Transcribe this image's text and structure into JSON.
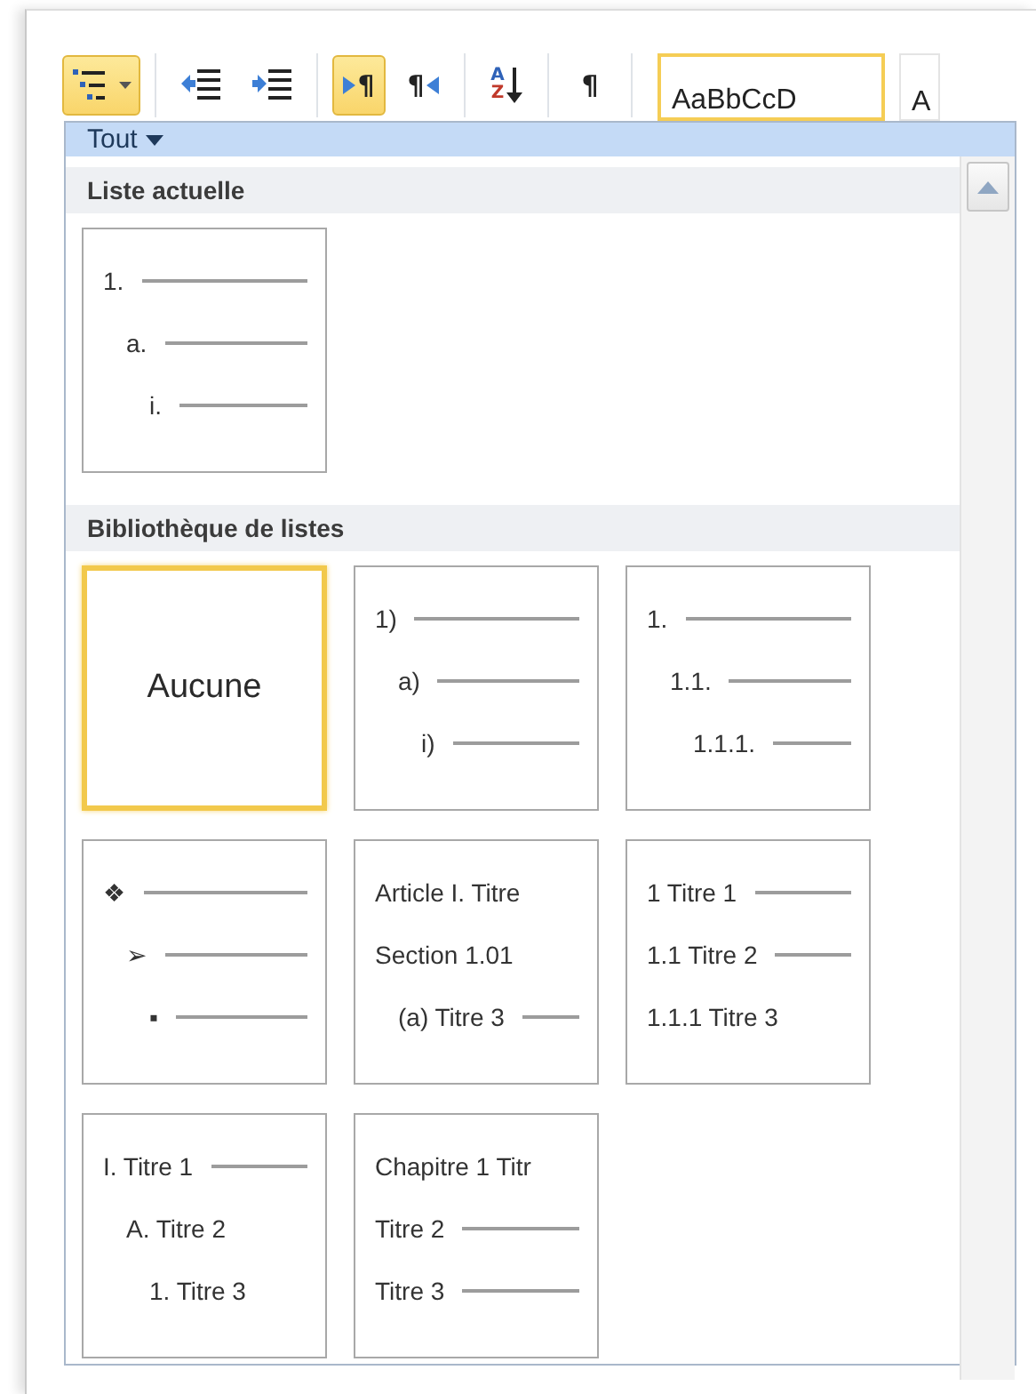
{
  "toolbar": {
    "groups": [
      [
        {
          "kind": "multilevel-list",
          "selected": true
        }
      ],
      [
        {
          "kind": "decrease-indent",
          "selected": false
        },
        {
          "kind": "increase-indent",
          "selected": false
        }
      ],
      [
        {
          "kind": "left-to-right",
          "mark": "¶",
          "selected": true
        },
        {
          "kind": "right-to-left",
          "mark": "¶",
          "selected": false
        }
      ],
      [
        {
          "kind": "sort",
          "letters": [
            "A",
            "Z"
          ],
          "selected": false
        }
      ],
      [
        {
          "kind": "show-marks",
          "mark": "¶",
          "selected": false
        }
      ]
    ],
    "styles": [
      {
        "sample": "AaBbCcD",
        "selected": true
      },
      {
        "sample": "A",
        "selected": false
      }
    ]
  },
  "dropdown": {
    "filter": {
      "label": "Tout"
    },
    "sections": [
      {
        "title": "Liste actuelle",
        "tiles": [
          {
            "kind": "outline",
            "selected": false,
            "lines": [
              {
                "label": "1.",
                "rule": true,
                "children": [
                  {
                    "label": "a.",
                    "rule": true,
                    "children": [
                      {
                        "label": "i.",
                        "rule": true
                      }
                    ]
                  }
                ]
              }
            ]
          }
        ]
      },
      {
        "title": "Bibliothèque de listes",
        "tiles": [
          {
            "kind": "none",
            "selected": true,
            "label": "Aucune"
          },
          {
            "kind": "outline",
            "selected": false,
            "lines": [
              {
                "label": "1)",
                "rule": true,
                "children": [
                  {
                    "label": "a)",
                    "rule": true,
                    "children": [
                      {
                        "label": "i)",
                        "rule": true
                      }
                    ]
                  }
                ]
              }
            ]
          },
          {
            "kind": "outline",
            "selected": false,
            "lines": [
              {
                "label": "1.",
                "rule": true,
                "children": [
                  {
                    "label": "1.1.",
                    "rule": true,
                    "children": [
                      {
                        "label": "1.1.1.",
                        "rule": true
                      }
                    ]
                  }
                ]
              }
            ]
          },
          {
            "kind": "outline",
            "selected": false,
            "lines": [
              {
                "label": "❖",
                "rule": true,
                "children": [
                  {
                    "label": "➢",
                    "rule": true,
                    "children": [
                      {
                        "label": "▪",
                        "rule": true
                      }
                    ]
                  }
                ]
              }
            ]
          },
          {
            "kind": "outline",
            "selected": false,
            "lines": [
              {
                "label": "Article I. Titre",
                "rule": false
              },
              {
                "label": "Section 1.01",
                "rule": false,
                "children": [
                  {
                    "label": "(a) Titre 3",
                    "rule": true
                  }
                ]
              }
            ]
          },
          {
            "kind": "outline",
            "selected": false,
            "lines": [
              {
                "label": "1 Titre 1",
                "rule": true
              },
              {
                "label": "1.1 Titre 2",
                "rule": true
              },
              {
                "label": "1.1.1 Titre 3",
                "rule": false
              }
            ]
          },
          {
            "kind": "outline",
            "selected": false,
            "lines": [
              {
                "label": "I. Titre 1",
                "rule": true,
                "children": [
                  {
                    "label": "A. Titre 2",
                    "rule": false,
                    "children": [
                      {
                        "label": "1. Titre 3",
                        "rule": false
                      }
                    ]
                  }
                ]
              }
            ]
          },
          {
            "kind": "outline",
            "selected": false,
            "lines": [
              {
                "label": "Chapitre 1 Titr",
                "rule": false
              },
              {
                "label": "Titre 2",
                "rule": true
              },
              {
                "label": "Titre 3",
                "rule": true
              }
            ]
          }
        ]
      }
    ]
  }
}
